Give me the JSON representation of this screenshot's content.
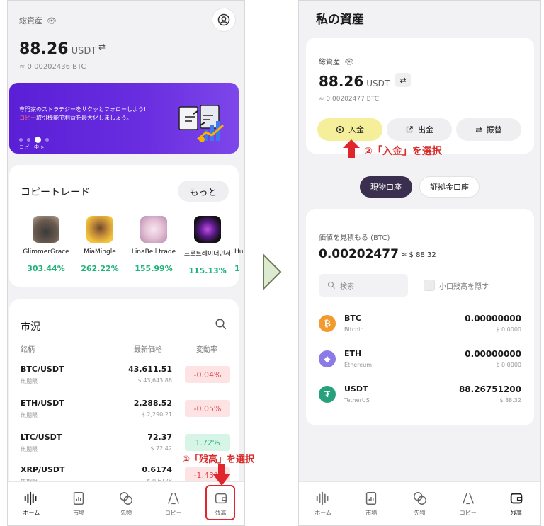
{
  "left": {
    "total_label": "総資産",
    "amount": "88.26",
    "unit": "USDT",
    "btc_equiv": "≈ 0.00202436 BTC",
    "banner": {
      "line1": "専門家のストラテジーをサクッとフォローしよう!",
      "line2_hl": "コピー",
      "line2_rest": "取引機能で利益を最大化しましょう。",
      "sub": "コピー中 >"
    },
    "copy": {
      "title": "コピートレード",
      "more": "もっと",
      "traders": [
        {
          "name": "GlimmerGrace",
          "pct": "303.44%"
        },
        {
          "name": "MiaMingle",
          "pct": "262.22%"
        },
        {
          "name": "LinaBell trade",
          "pct": "155.99%"
        },
        {
          "name": "프로트레이더인서",
          "pct": "115.13%"
        },
        {
          "name": "Hu",
          "pct": "1"
        }
      ]
    },
    "market": {
      "title": "市況",
      "col_pair": "銘柄",
      "col_price": "最新価格",
      "col_change": "変動率",
      "rows": [
        {
          "pair": "BTC/USDT",
          "sub": "無期限",
          "price": "43,611.51",
          "usd": "$ 43,643.88",
          "change": "-0.04%",
          "dir": "neg"
        },
        {
          "pair": "ETH/USDT",
          "sub": "無期限",
          "price": "2,288.52",
          "usd": "$ 2,290.21",
          "change": "-0.05%",
          "dir": "neg"
        },
        {
          "pair": "LTC/USDT",
          "sub": "無期限",
          "price": "72.37",
          "usd": "$ 72.42",
          "change": "1.72%",
          "dir": "pos"
        },
        {
          "pair": "XRP/USDT",
          "sub": "無期限",
          "price": "0.6174",
          "usd": "$ 0.6178",
          "change": "-1.43%",
          "dir": "neg"
        }
      ]
    },
    "nav": [
      "ホーム",
      "市場",
      "先物",
      "コピー",
      "残高"
    ]
  },
  "annotations": {
    "step1": "①「残高」を選択",
    "step2": "②「入金」を選択"
  },
  "right": {
    "title": "私の資産",
    "total_label": "総資産",
    "amount": "88.26",
    "unit": "USDT",
    "btc_equiv": "≈ 0.00202477 BTC",
    "actions": [
      "入金",
      "出金",
      "振替"
    ],
    "tabs": [
      "現物口座",
      "証拠金口座"
    ],
    "estimate_label": "価値を見積もる (BTC)",
    "estimate_value": "0.00202477",
    "estimate_usd": "≈ $ 88.32",
    "search_placeholder": "検索",
    "hide_small": "小口残高を隠す",
    "coins": [
      {
        "sym": "BTC",
        "name": "Bitcoin",
        "amt": "0.00000000",
        "usd": "$ 0.0000",
        "color": "#f29a2e",
        "glyph": "₿"
      },
      {
        "sym": "ETH",
        "name": "Ethereum",
        "amt": "0.00000000",
        "usd": "$ 0.0000",
        "color": "#8c7ae6",
        "glyph": "◆"
      },
      {
        "sym": "USDT",
        "name": "TetherUS",
        "amt": "88.26751200",
        "usd": "$ 88.32",
        "color": "#26a17b",
        "glyph": "₮"
      }
    ],
    "nav": [
      "ホーム",
      "市場",
      "先物",
      "コピー",
      "残高"
    ]
  }
}
